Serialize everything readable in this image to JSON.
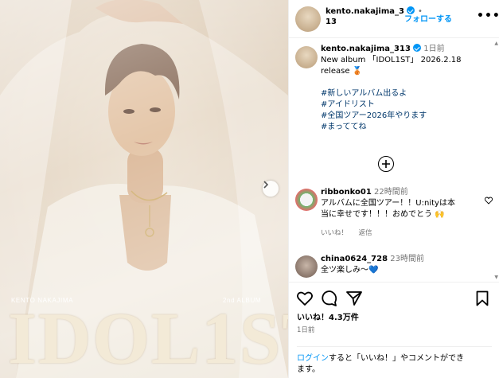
{
  "post": {
    "album_artist": "KENTO NAKAJIMA",
    "album_number": "2nd ALBUM",
    "album_title": "IDOL1ST"
  },
  "header": {
    "username_line1": "kento.nakajima_3",
    "username_line2": "13",
    "follow_label": "フォローする",
    "separator": "•",
    "more_label": "•••"
  },
  "caption": {
    "username": "kento.nakajima_313",
    "time": "1日前",
    "line1": "New album 「IDOL1ST」 2026.2.18",
    "line2": "release 🥉",
    "hashtags": [
      "#新しいアルバム出るよ",
      "#アイドリスト",
      "#全国ツアー2026年やります",
      "#まっててね"
    ]
  },
  "comments": [
    {
      "username": "ribbonko01",
      "time": "22時間前",
      "line1": "アルバムに全国ツアー！！U:nityは本",
      "line2": "当に幸せです！！！おめでとう 🙌",
      "like_label": "いいね！",
      "reply_label": "返信"
    },
    {
      "username": "china0624_728",
      "time": "23時間前",
      "line1": "全ツ楽しみ〜💙"
    }
  ],
  "actions": {
    "likes": "いいね！4.3万件",
    "date": "1日前",
    "login_link": "ログイン",
    "login_rest1": "すると「いいね！」やコメントができ",
    "login_rest2": "ます。"
  },
  "icons": [
    "heart-icon",
    "comment-icon",
    "share-icon",
    "bookmark-icon",
    "plus-circle-icon",
    "chevron-right-icon",
    "verified-icon"
  ],
  "colors": {
    "accent": "#0095f6",
    "hashtag": "#00376b",
    "muted": "#737373"
  }
}
